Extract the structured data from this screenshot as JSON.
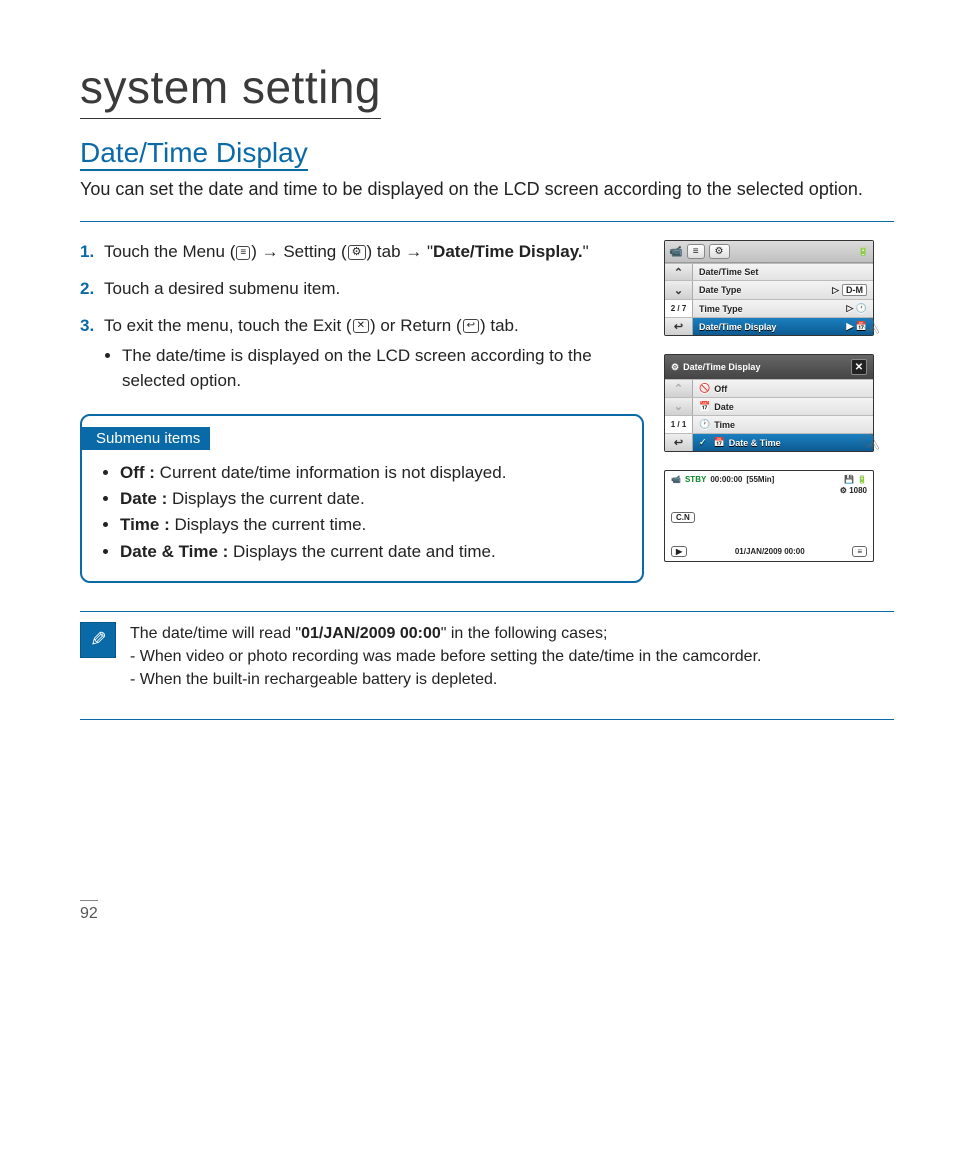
{
  "title": "system setting",
  "section": "Date/Time Display",
  "intro": "You can set the date and time to be displayed on the LCD screen according to the selected option.",
  "steps": [
    {
      "n": "1.",
      "pre": "Touch the Menu (",
      "mid1": ") ",
      "mid2": " Setting (",
      "mid3": ") tab ",
      "mid4": " \"",
      "bold": "Date/Time Display.",
      "post": "\""
    },
    {
      "n": "2.",
      "text": "Touch a desired submenu item."
    },
    {
      "n": "3.",
      "pre": "To exit the menu, touch the Exit (",
      "mid": ") or Return (",
      "post": ") tab.",
      "bullet": "The date/time is displayed on the LCD screen according to the selected option."
    }
  ],
  "submenu": {
    "badge": "Submenu items",
    "items": [
      {
        "b": "Off :",
        "t": " Current date/time information is not displayed."
      },
      {
        "b": "Date :",
        "t": " Displays the current date."
      },
      {
        "b": "Time :",
        "t": " Displays the current time."
      },
      {
        "b": "Date & Time :",
        "t": " Displays the current date and time."
      }
    ]
  },
  "note": {
    "lead_a": "The date/time will read \"",
    "lead_bold": "01/JAN/2009 00:00",
    "lead_b": "\" in the following cases;",
    "lines": [
      "When video or photo recording was made before setting the date/time in the camcorder.",
      "When the built-in rechargeable battery is depleted."
    ]
  },
  "lcd1": {
    "rows": [
      "Date/Time Set",
      "Date Type",
      "Time Type",
      "Date/Time Display"
    ],
    "counter": "2 / 7"
  },
  "lcd2": {
    "title": "Date/Time Display",
    "rows": [
      "Off",
      "Date",
      "Time",
      "Date & Time"
    ],
    "counter": "1 / 1"
  },
  "lcd3": {
    "stby": "STBY",
    "time": "00:00:00",
    "remain": "[55Min]",
    "res": "1080",
    "cn": "C.N",
    "stamp": "01/JAN/2009 00:00"
  },
  "page": "92"
}
